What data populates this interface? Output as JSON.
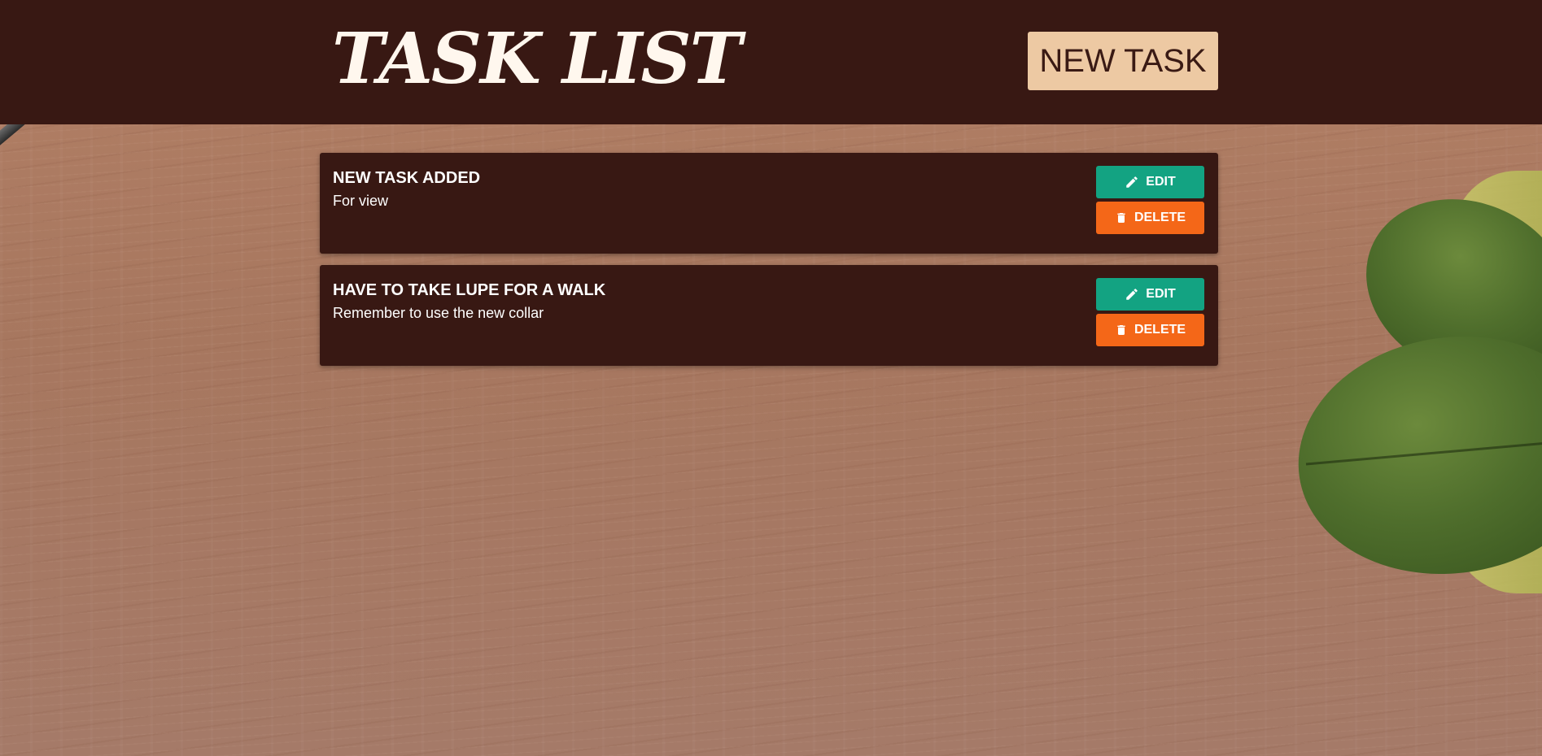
{
  "header": {
    "title": "TASK LIST",
    "new_task_label": "NEW TASK"
  },
  "tasks": [
    {
      "title": "NEW TASK ADDED",
      "description": "For view",
      "edit_label": "EDIT",
      "delete_label": "DELETE"
    },
    {
      "title": "HAVE TO TAKE LUPE FOR A WALK",
      "description": "Remember to use the new collar",
      "edit_label": "EDIT",
      "delete_label": "DELETE"
    }
  ],
  "icons": {
    "edit": "pencil-icon",
    "delete": "trash-icon"
  },
  "colors": {
    "header_bg": "#381813",
    "card_bg": "#381813",
    "new_task_bg": "#edc9a3",
    "edit_bg": "#13a382",
    "delete_bg": "#f46718"
  }
}
